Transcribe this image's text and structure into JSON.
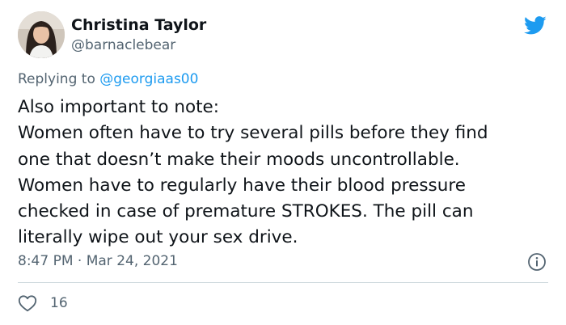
{
  "tweet": {
    "author": {
      "name": "Christina Taylor",
      "handle": "@barnaclebear"
    },
    "replying_prefix": "Replying to ",
    "replying_to": "@georgiaas00",
    "text_lines": [
      "Also important to note:",
      "Women often have to try several pills before they find",
      "one that doesn’t make their moods uncontrollable.",
      "Women have to regularly have their blood pressure",
      "checked in case of premature STROKES. The pill can",
      "literally wipe out your sex drive."
    ],
    "time": "8:47 PM",
    "separator": "·",
    "date": "Mar 24, 2021",
    "likes": "16"
  },
  "icons": {
    "logo": "twitter-bird-icon",
    "info": "info-icon",
    "like": "heart-icon"
  },
  "colors": {
    "brand": "#1d9bf0",
    "text": "#0f1419",
    "secondary": "#536471",
    "divider": "#cfd9de"
  }
}
